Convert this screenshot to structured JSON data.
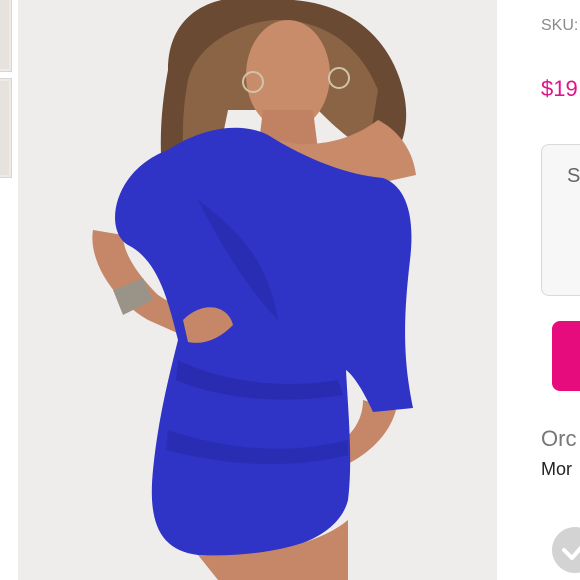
{
  "product": {
    "sku_label": "SKU:",
    "price": "$19",
    "option_label": "S",
    "orders_label": "Orc",
    "orders_value": "Mor"
  },
  "icons": {
    "purchased_badge": "check-circle-icon"
  },
  "colors": {
    "price": "#e0138d",
    "cta_button": "#e60c7e",
    "dress": "#2f33c6",
    "photo_background": "#efedec"
  }
}
